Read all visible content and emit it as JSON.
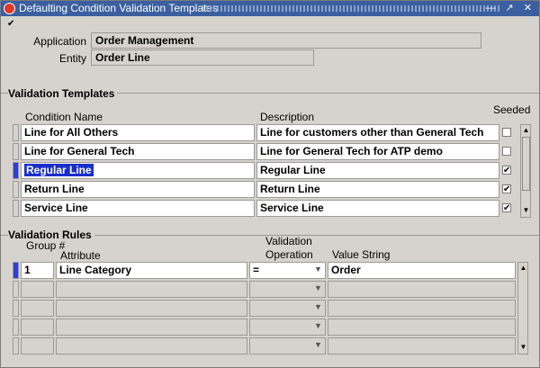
{
  "window": {
    "title": "Defaulting Condition Validation Templates",
    "buttons": "— ↗ ✕"
  },
  "header": {
    "checkbox": "✔",
    "application_label": "Application",
    "application_value": "Order Management",
    "entity_label": "Entity",
    "entity_value": "Order Line"
  },
  "templates": {
    "title": "Validation Templates",
    "seeded_label": "Seeded",
    "col_condition": "Condition Name",
    "col_description": "Description",
    "rows": [
      {
        "name": "Line for All Others",
        "desc": "Line for customers other than General Tech",
        "seeded": ""
      },
      {
        "name": "Line for General Tech",
        "desc": "Line for General Tech for ATP demo",
        "seeded": ""
      },
      {
        "name": "Regular Line",
        "desc": "Regular Line",
        "seeded": "✔"
      },
      {
        "name": "Return Line",
        "desc": "Return Line",
        "seeded": "✔"
      },
      {
        "name": "Service Line",
        "desc": "Service Line",
        "seeded": "✔"
      }
    ]
  },
  "rules": {
    "title": "Validation Rules",
    "col_group": "Group #",
    "col_attribute": "Attribute",
    "col_operation_1": "Validation",
    "col_operation_2": "Operation",
    "col_value": "Value String",
    "rows": [
      {
        "group": "1",
        "attribute": "Line Category",
        "operation": "=",
        "value": "Order"
      },
      {
        "group": "",
        "attribute": "",
        "operation": "",
        "value": ""
      },
      {
        "group": "",
        "attribute": "",
        "operation": "",
        "value": ""
      },
      {
        "group": "",
        "attribute": "",
        "operation": "",
        "value": ""
      },
      {
        "group": "",
        "attribute": "",
        "operation": "",
        "value": ""
      }
    ]
  },
  "colors": {
    "titlebar": "#3b5f9f",
    "selected_row": "#2f3ed8",
    "highlight": "#1a2fc9"
  }
}
